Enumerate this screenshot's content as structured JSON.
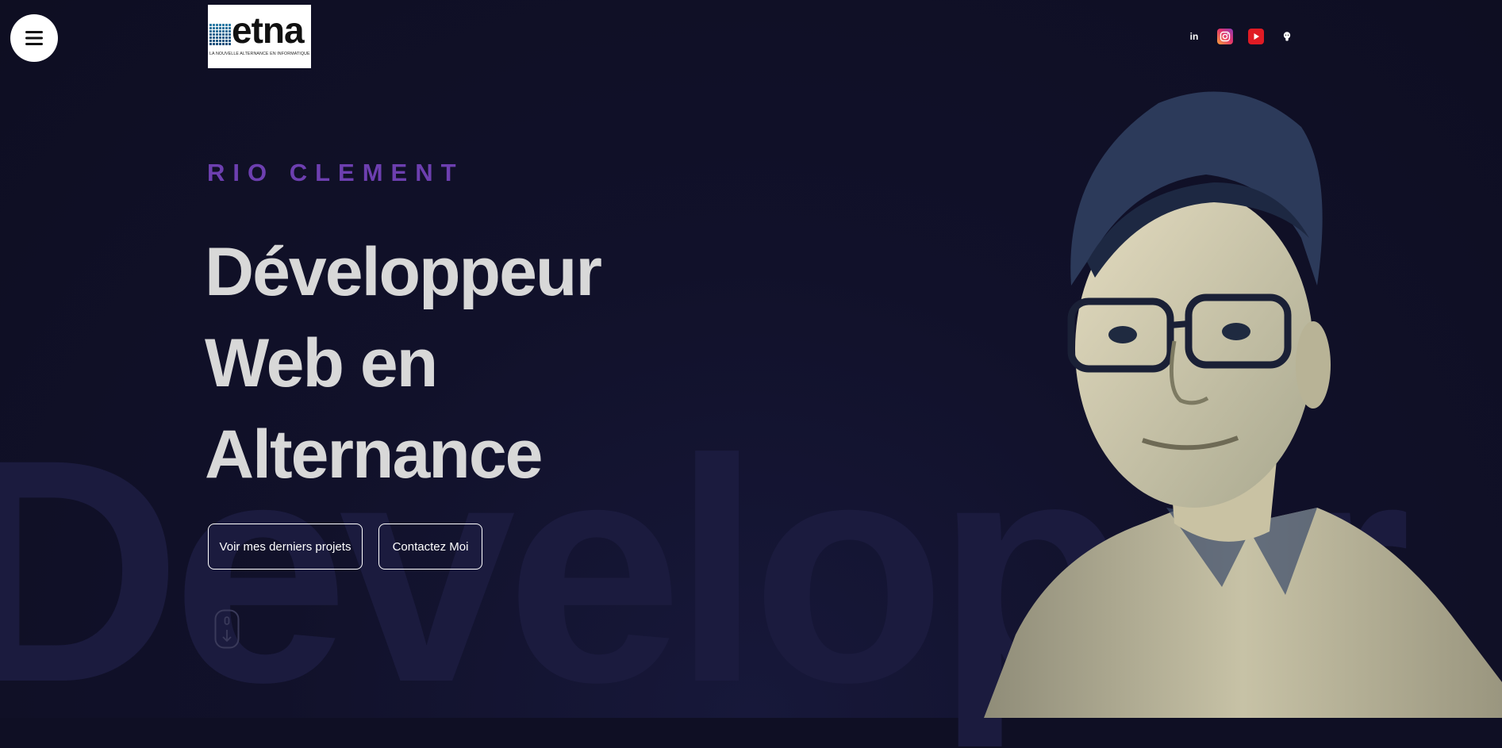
{
  "nav": {
    "menu_icon": "hamburger-icon"
  },
  "logo": {
    "word": "etna",
    "tagline": "LA NOUVELLE ALTERNANCE EN INFORMATIQUE"
  },
  "socials": [
    {
      "name": "linkedin",
      "icon": "linkedin-icon",
      "label": "in"
    },
    {
      "name": "instagram",
      "icon": "instagram-icon"
    },
    {
      "name": "youtube",
      "icon": "youtube-icon"
    },
    {
      "name": "github",
      "icon": "github-icon"
    }
  ],
  "hero": {
    "name": "RIO CLEMENT",
    "headline_lines": [
      "Développeur",
      "Web en",
      "Alternance"
    ],
    "background_word": "Developer",
    "buttons": {
      "projects": "Voir mes derniers projets",
      "contact": "Contactez Moi"
    },
    "scroll_icon": "mouse-scroll-icon"
  },
  "colors": {
    "background": "#0f0f24",
    "accent": "#6d3fb0",
    "headline": "#d8d8d8"
  }
}
